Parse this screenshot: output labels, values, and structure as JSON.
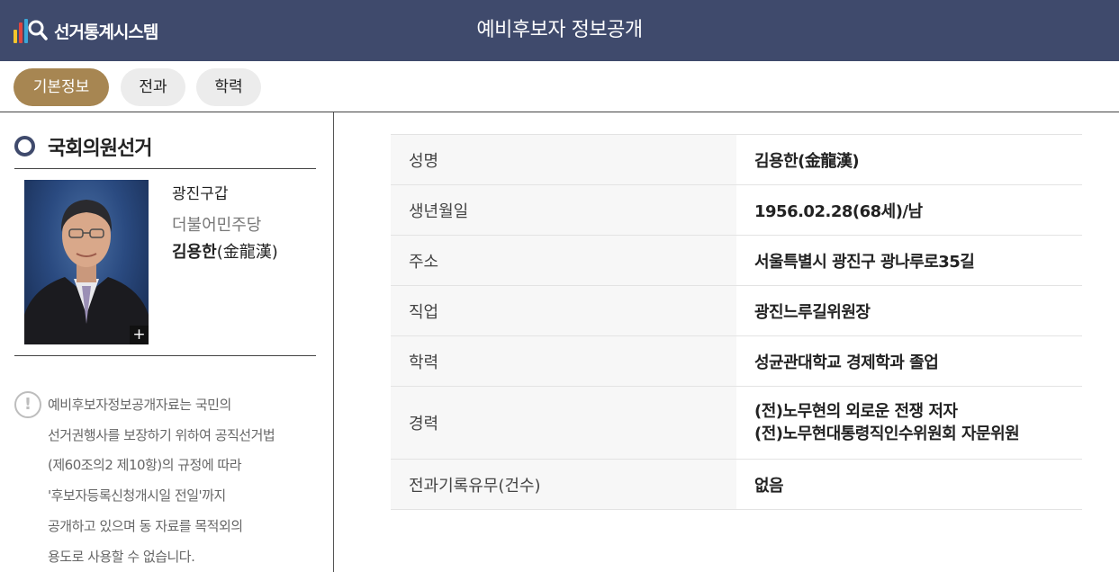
{
  "header": {
    "logo_text": "선거통계시스템",
    "title": "예비후보자 정보공개"
  },
  "tabs": [
    {
      "label": "기본정보",
      "active": true
    },
    {
      "label": "전과",
      "active": false
    },
    {
      "label": "학력",
      "active": false
    }
  ],
  "election": {
    "title": "국회의원선거"
  },
  "candidate": {
    "district": "광진구갑",
    "party": "더불어민주당",
    "name": "김용한",
    "name_hanja": "(金龍漢)",
    "photo_expand_label": "+"
  },
  "notice": {
    "icon_symbol": "!",
    "lines": [
      "예비후보자정보공개자료는 국민의",
      "선거권행사를 보장하기 위하여 공직선거법",
      "(제60조의2 제10항)의 규정에 따라",
      "'후보자등록신청개시일 전일'까지",
      "공개하고 있으며 동 자료를 목적외의",
      "용도로 사용할 수 없습니다."
    ]
  },
  "info_rows": [
    {
      "label": "성명",
      "value": "김용한(金龍漢)"
    },
    {
      "label": "생년월일",
      "value": "1956.02.28(68세)/남"
    },
    {
      "label": "주소",
      "value": "서울특별시 광진구 광나루로35길"
    },
    {
      "label": "직업",
      "value": "광진느루길위원장"
    },
    {
      "label": "학력",
      "value": "성균관대학교 경제학과 졸업"
    },
    {
      "label": "경력",
      "values": [
        "(전)노무현의 외로운 전쟁 저자",
        "(전)노무현대통령직인수위원회 자문위원"
      ]
    },
    {
      "label": "전과기록유무(건수)",
      "value": "없음"
    }
  ],
  "colors": {
    "header_bg": "#3f4a6c",
    "tab_active_bg": "#a78652",
    "tab_inactive_bg": "#ececec",
    "label_bg": "#f7f7f7"
  }
}
